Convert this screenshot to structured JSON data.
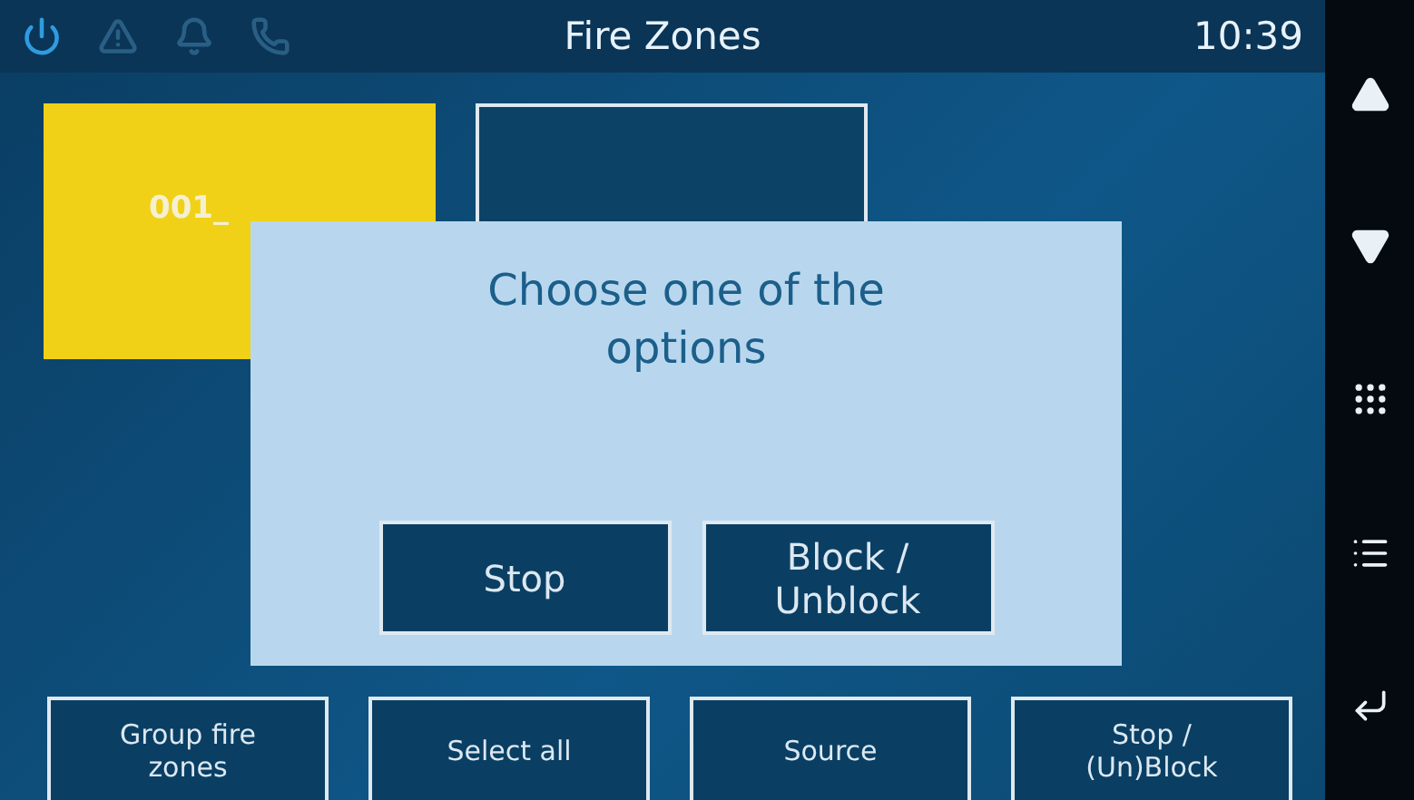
{
  "status_bar": {
    "title": "Fire Zones",
    "time": "10:39",
    "icons": [
      {
        "kind": "power",
        "active": true
      },
      {
        "kind": "warning",
        "active": false
      },
      {
        "kind": "bell",
        "active": false
      },
      {
        "kind": "phone",
        "active": false
      }
    ]
  },
  "zones": [
    {
      "label": "001_",
      "highlighted": true
    },
    {
      "highlighted": false
    }
  ],
  "dialog": {
    "message": "Choose one of the options",
    "buttons": [
      "Stop",
      "Block / Unblock"
    ]
  },
  "actions": [
    "Group fire zones",
    "Select all",
    "Source",
    "Stop / (Un)Block"
  ]
}
